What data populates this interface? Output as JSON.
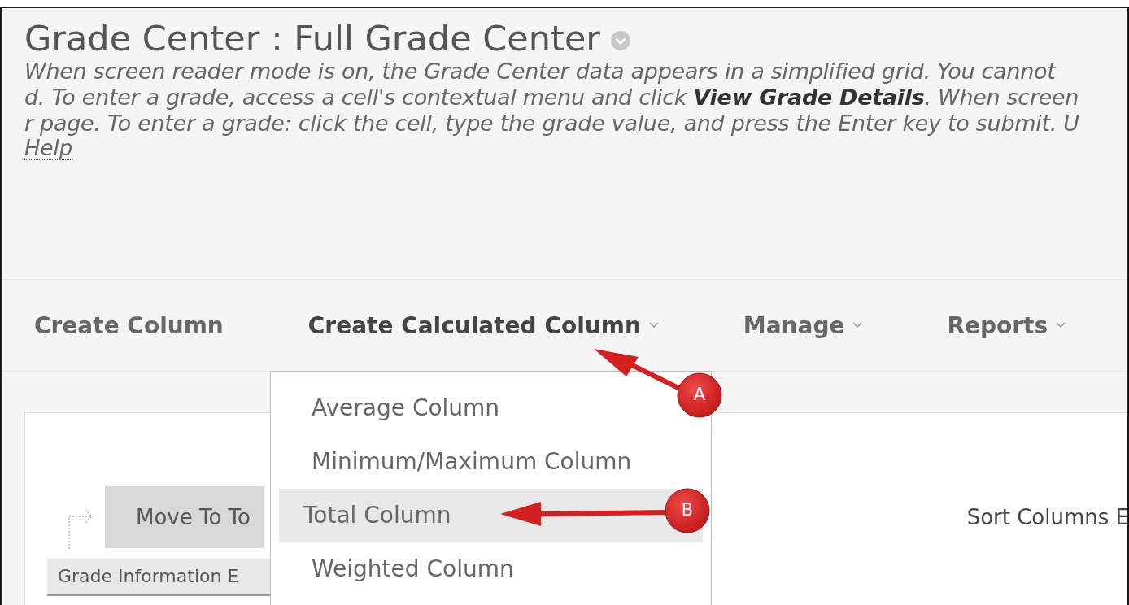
{
  "page": {
    "title": "Grade Center : Full Grade Center",
    "description_lines": [
      "When screen reader mode is on, the Grade Center data appears in a simplified grid. You cannot",
      "d. To enter a grade, access a cell's contextual menu and click **View Grade Details**. When screen",
      "r page. To enter a grade: click the cell, type the grade value, and press the Enter key to submit. U"
    ],
    "help_link": "Help"
  },
  "toolbar": [
    {
      "label": "Create Column",
      "has_menu": false,
      "expanded": false
    },
    {
      "label": "Create Calculated Column",
      "has_menu": true,
      "expanded": true
    },
    {
      "label": "Manage",
      "has_menu": true,
      "expanded": false
    },
    {
      "label": "Reports",
      "has_menu": true,
      "expanded": false
    }
  ],
  "menu": [
    {
      "label": "Average Column",
      "selected": false
    },
    {
      "label": "Minimum/Maximum Column",
      "selected": false
    },
    {
      "label": "Total Column",
      "selected": true
    },
    {
      "label": "Weighted Column",
      "selected": false
    }
  ],
  "content": {
    "move_button": "Move To To",
    "sort_label": "Sort Columns E",
    "info_bar": "Grade Information E"
  },
  "annotations": [
    {
      "letter": "A"
    },
    {
      "letter": "B"
    }
  ]
}
